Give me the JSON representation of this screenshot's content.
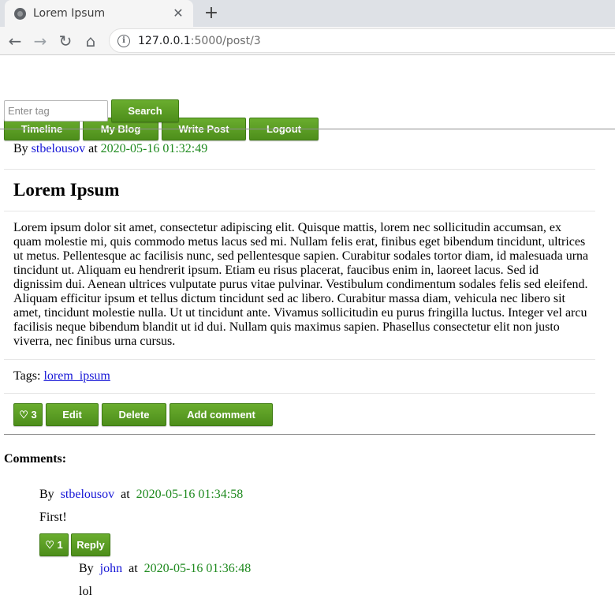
{
  "browser": {
    "tab_title": "Lorem Ipsum",
    "tab_close": "✕",
    "new_tab": "+",
    "url_host": "127.0.0.1",
    "url_rest": ":5000/post/3",
    "back": "←",
    "forward": "→",
    "reload": "↻",
    "home": "⌂"
  },
  "nav": {
    "timeline": "Timeline",
    "my_blog": "My Blog",
    "write_post": "Write Post",
    "logout": "Logout"
  },
  "tag_search": {
    "placeholder": "Enter tag",
    "button": "Search"
  },
  "post": {
    "by": "By",
    "author": "stbelousov",
    "at": "at",
    "timestamp": "2020-05-16 01:32:49",
    "title": "Lorem Ipsum",
    "body": "Lorem ipsum dolor sit amet, consectetur adipiscing elit. Quisque mattis, lorem nec sollicitudin accumsan, ex quam molestie mi, quis commodo metus lacus sed mi. Nullam felis erat, finibus eget bibendum tincidunt, ultrices ut metus. Pellentesque ac facilisis nunc, sed pellentesque sapien. Curabitur sodales tortor diam, id malesuada urna tincidunt ut. Aliquam eu hendrerit ipsum. Etiam eu risus placerat, faucibus enim in, laoreet lacus. Sed id dignissim dui. Aenean ultrices vulputate purus vitae pulvinar. Vestibulum condimentum sodales felis sed eleifend. Aliquam efficitur ipsum et tellus dictum tincidunt sed ac libero. Curabitur massa diam, vehicula nec libero sit amet, tincidunt molestie nulla. Ut ut tincidunt ante. Vivamus sollicitudin eu purus fringilla luctus. Integer vel arcu facilisis neque bibendum blandit ut id dui. Nullam quis maximus sapien. Phasellus consectetur elit non justo viverra, nec finibus urna cursus.",
    "tags_label": "Tags:",
    "tag": "lorem_ipsum",
    "like_label": "♡ 3",
    "edit": "Edit",
    "delete": "Delete",
    "add_comment": "Add comment"
  },
  "comments": {
    "heading": "Comments:",
    "items": [
      {
        "by": "By",
        "author": "stbelousov",
        "at": "at",
        "timestamp": "2020-05-16 01:34:58",
        "text": "First!",
        "like_label": "♡ 1",
        "reply": "Reply"
      },
      {
        "by": "By",
        "author": "john",
        "at": "at",
        "timestamp": "2020-05-16 01:36:48",
        "text": "lol"
      }
    ]
  },
  "colors": {
    "button_green": "#5a9e24",
    "link_blue": "#1515d6",
    "timestamp_green": "#1f8a1f"
  }
}
